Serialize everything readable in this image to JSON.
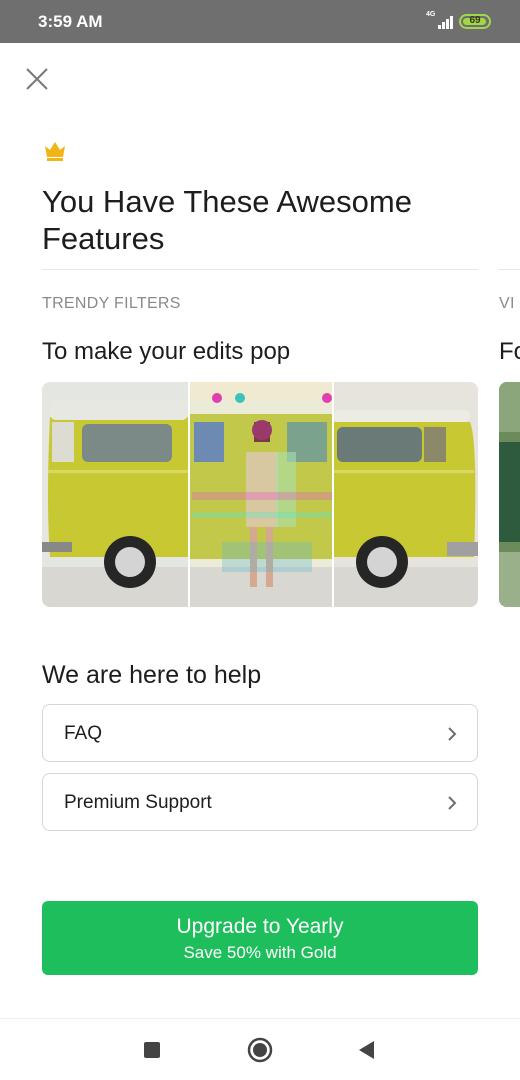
{
  "status_bar": {
    "time": "3:59 AM",
    "network": "4G",
    "battery": "69",
    "battery_color": "#a4d64a"
  },
  "header": {
    "close_icon": "close-icon",
    "badge_icon": "crown-icon",
    "title": "You Have These Awesome Features"
  },
  "features": {
    "current": {
      "label": "TRENDY FILTERS",
      "title": "To make your edits pop",
      "image": "yellow-van-filter-preview"
    },
    "next": {
      "label": "VI",
      "title": "Fo"
    }
  },
  "help": {
    "title": "We are here to help",
    "items": [
      {
        "label": "FAQ",
        "icon": "chevron-right-icon"
      },
      {
        "label": "Premium Support",
        "icon": "chevron-right-icon"
      }
    ]
  },
  "cta": {
    "title": "Upgrade to Yearly",
    "subtitle": "Save 50% with Gold",
    "color": "#1fbe5d"
  },
  "nav_bar": {
    "items": [
      "recents-icon",
      "home-icon",
      "back-icon"
    ]
  }
}
